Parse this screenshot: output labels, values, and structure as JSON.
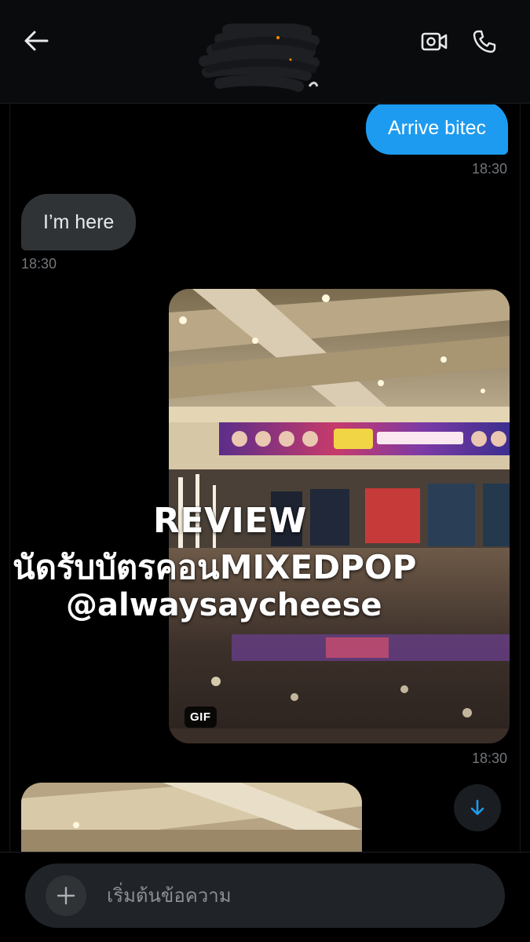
{
  "header": {
    "contact_name": "",
    "back_icon": "arrow-left-icon",
    "video_icon": "video-call-icon",
    "call_icon": "phone-icon"
  },
  "messages": [
    {
      "direction": "outgoing",
      "text": "Arrive bitec",
      "time": "18:30"
    },
    {
      "direction": "incoming",
      "text": "I’m here",
      "time": "18:30"
    },
    {
      "direction": "outgoing",
      "type": "gif",
      "badge": "GIF",
      "time": "18:30"
    }
  ],
  "overlay": {
    "line1": "REVIEW",
    "line2": "นัดรับบัตรคอนMIXEDPOP",
    "line3": "@alwaysaycheese"
  },
  "composer": {
    "placeholder": "เริ่มต้นข้อความ",
    "plus_icon": "plus-icon",
    "voice_icon": "voice-waveform-icon"
  },
  "colors": {
    "accent": "#1d9bf0",
    "incoming_bubble": "#2f3336",
    "background": "#000000",
    "voice": "#8b5cf6"
  }
}
